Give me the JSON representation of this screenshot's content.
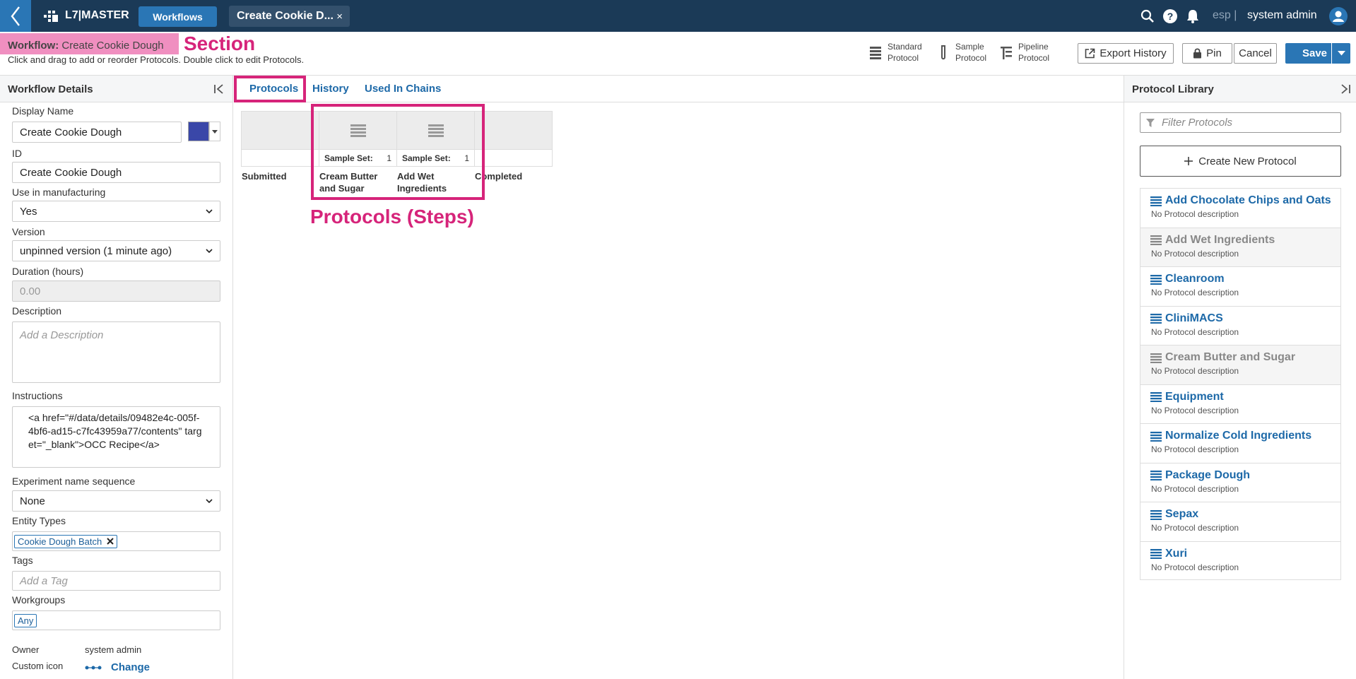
{
  "topbar": {
    "brand": "L7|MASTER",
    "workflows_button": "Workflows",
    "open_tab": "Create Cookie D...",
    "tab_close": "×",
    "env": "esp |",
    "user": "system admin"
  },
  "header": {
    "title_prefix": "Workflow:",
    "title_name": "Create Cookie Dough",
    "section_annotation": "Section",
    "hint": "Click and drag to add or reorder Protocols. Double click to edit Protocols.",
    "protocol_types": [
      {
        "label_line1": "Standard",
        "label_line2": "Protocol",
        "icon": "standard-protocol-icon"
      },
      {
        "label_line1": "Sample",
        "label_line2": "Protocol",
        "icon": "sample-protocol-icon"
      },
      {
        "label_line1": "Pipeline",
        "label_line2": "Protocol",
        "icon": "pipeline-protocol-icon"
      }
    ],
    "export_history": "Export History",
    "pin": "Pin",
    "cancel": "Cancel",
    "save": "Save"
  },
  "details": {
    "panel_title": "Workflow Details",
    "display_name_label": "Display Name",
    "display_name": "Create Cookie Dough",
    "id_label": "ID",
    "id": "Create Cookie Dough",
    "manufacturing_label": "Use in manufacturing",
    "manufacturing": "Yes",
    "version_label": "Version",
    "version": "unpinned version (1 minute ago)",
    "duration_label": "Duration (hours)",
    "duration": "0.00",
    "description_label": "Description",
    "description_placeholder": "Add a Description",
    "instructions_label": "Instructions",
    "instructions": "<a href=\"#/data/details/09482e4c-005f-4bf6-ad15-c7fc43959a77/contents\" target=\"_blank\">OCC Recipe</a>",
    "exp_seq_label": "Experiment name sequence",
    "exp_seq": "None",
    "entity_types_label": "Entity Types",
    "entity_type_chip": "Cookie Dough Batch",
    "tags_label": "Tags",
    "tags_placeholder": "Add a Tag",
    "workgroups_label": "Workgroups",
    "workgroup_chip": "Any",
    "owner_label": "Owner",
    "owner": "system admin",
    "custom_icon_label": "Custom icon",
    "change": "Change",
    "color": "#3a47a8"
  },
  "main": {
    "tabs": [
      "Protocols",
      "History",
      "Used In Chains"
    ],
    "steps": [
      {
        "name_line1": "Submitted",
        "name_line2": "",
        "sample_label": "",
        "count": ""
      },
      {
        "name_line1": "Cream Butter",
        "name_line2": "and Sugar",
        "sample_label": "Sample Set:",
        "count": "1"
      },
      {
        "name_line1": "Add Wet",
        "name_line2": "Ingredients",
        "sample_label": "Sample Set:",
        "count": "1"
      },
      {
        "name_line1": "Completed",
        "name_line2": "",
        "sample_label": "",
        "count": ""
      }
    ],
    "protocols_annotation": "Protocols (Steps)"
  },
  "library": {
    "title": "Protocol Library",
    "filter_placeholder": "Filter Protocols",
    "create_new": "Create New Protocol",
    "items": [
      {
        "name": "Add Chocolate Chips and Oats",
        "desc": "No Protocol description",
        "used": false
      },
      {
        "name": "Add Wet Ingredients",
        "desc": "No Protocol description",
        "used": true
      },
      {
        "name": "Cleanroom",
        "desc": "No Protocol description",
        "used": false
      },
      {
        "name": "CliniMACS",
        "desc": "No Protocol description",
        "used": false
      },
      {
        "name": "Cream Butter and Sugar",
        "desc": "No Protocol description",
        "used": true
      },
      {
        "name": "Equipment",
        "desc": "No Protocol description",
        "used": false
      },
      {
        "name": "Normalize Cold Ingredients",
        "desc": "No Protocol description",
        "used": false
      },
      {
        "name": "Package Dough",
        "desc": "No Protocol description",
        "used": false
      },
      {
        "name": "Sepax",
        "desc": "No Protocol description",
        "used": false
      },
      {
        "name": "Xuri",
        "desc": "No Protocol description",
        "used": false
      }
    ]
  },
  "colors": {
    "topbar": "#1b3a57",
    "accent": "#2a76b5",
    "annotation": "#d6247a",
    "link": "#1d69a8"
  }
}
